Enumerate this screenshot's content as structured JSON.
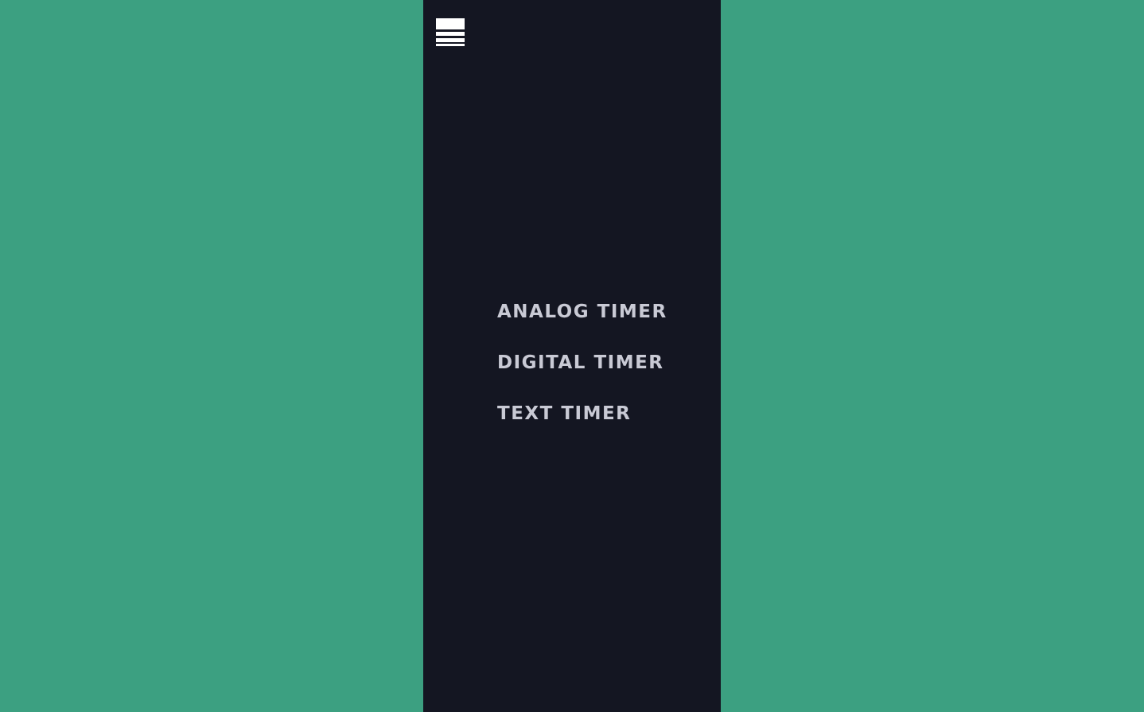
{
  "colors": {
    "background": "#3ca081",
    "panel": "#141622",
    "menu_text": "#c9cad5",
    "icon": "#ffffff"
  },
  "menu_button": {
    "icon": "hamburger-menu-icon"
  },
  "nav": {
    "items": [
      {
        "label": "ANALOG TIMER"
      },
      {
        "label": "DIGITAL TIMER"
      },
      {
        "label": "TEXT TIMER"
      }
    ]
  }
}
